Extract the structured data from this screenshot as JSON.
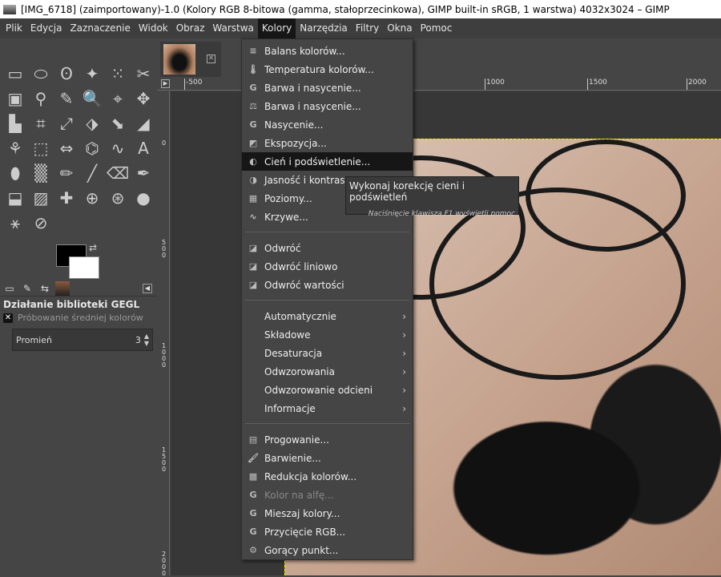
{
  "window": {
    "title": "[IMG_6718] (zaimportowany)-1.0 (Kolory RGB 8-bitowa (gamma, stałoprzecinkowa), GIMP built-in sRGB, 1 warstwa) 4032x3024 – GIMP"
  },
  "menubar": [
    "Plik",
    "Edycja",
    "Zaznaczenie",
    "Widok",
    "Obraz",
    "Warstwa",
    "Kolory",
    "Narzędzia",
    "Filtry",
    "Okna",
    "Pomoc"
  ],
  "menubar_active": "Kolory",
  "tools": [
    "▭",
    "⬭",
    "ʘ",
    "✦",
    "⁙",
    "✂",
    "▣",
    "⚲",
    "✎",
    "🔍",
    "⌖",
    "✥",
    "▙",
    "⌗",
    "⤢",
    "⬗",
    "⬊",
    "◢",
    "⚘",
    "⬚",
    "⇔",
    "⌬",
    "∿",
    "A",
    "⬮",
    "▒",
    "✏",
    "╱",
    "⌫",
    "✒",
    "⬓",
    "▨",
    "✚",
    "⊕",
    "⊛",
    "●",
    "⚹",
    "⊘"
  ],
  "panel": {
    "title": "Działanie biblioteki GEGL",
    "sample_label": "Próbowanie średniej kolorów",
    "radius_label": "Promień",
    "radius_value": "3"
  },
  "rulers": {
    "h": [
      "-500",
      "1000",
      "1500",
      "2000"
    ],
    "v": [
      "0",
      "500",
      "1000",
      "1500",
      "2000"
    ]
  },
  "menu": {
    "items": [
      {
        "label": "Balans kolorów...",
        "icon": "≡"
      },
      {
        "label": "Temperatura kolorów...",
        "icon": "🌡"
      },
      {
        "label": "Barwa i nasycenie...",
        "icon": "G"
      },
      {
        "label": "Barwa i nasycenie...",
        "icon": "⚖"
      },
      {
        "label": "Nasycenie...",
        "icon": "G"
      },
      {
        "label": "Ekspozycja...",
        "icon": "◩"
      },
      {
        "label": "Cień i podświetlenie...",
        "icon": "◐",
        "highlighted": true
      },
      {
        "label": "Jasność i kontrast...",
        "icon": "◑"
      },
      {
        "label": "Poziomy...",
        "icon": "▦"
      },
      {
        "label": "Krzywe...",
        "icon": "∿",
        "sep_after": true
      },
      {
        "label": "Odwróć",
        "icon": "◪"
      },
      {
        "label": "Odwróć liniowo",
        "icon": "◪"
      },
      {
        "label": "Odwróć wartości",
        "icon": "◪",
        "sep_after": true
      },
      {
        "label": "Automatycznie",
        "submenu": true
      },
      {
        "label": "Składowe",
        "submenu": true
      },
      {
        "label": "Desaturacja",
        "submenu": true
      },
      {
        "label": "Odwzorowania",
        "submenu": true
      },
      {
        "label": "Odwzorowanie odcieni",
        "submenu": true
      },
      {
        "label": "Informacje",
        "submenu": true,
        "sep_after": true
      },
      {
        "label": "Progowanie...",
        "icon": "▤"
      },
      {
        "label": "Barwienie...",
        "icon": "🖌"
      },
      {
        "label": "Redukcja kolorów...",
        "icon": "▩"
      },
      {
        "label": "Kolor na alfę...",
        "icon": "G",
        "disabled": true
      },
      {
        "label": "Mieszaj kolory...",
        "icon": "G"
      },
      {
        "label": "Przycięcie RGB...",
        "icon": "G"
      },
      {
        "label": "Gorący punkt...",
        "icon": "⚙"
      }
    ]
  },
  "tooltip": {
    "text": "Wykonaj korekcję cieni i podświetleń",
    "hint": "Naciśnięcie klawisza F1 wyświetli pomoc"
  }
}
